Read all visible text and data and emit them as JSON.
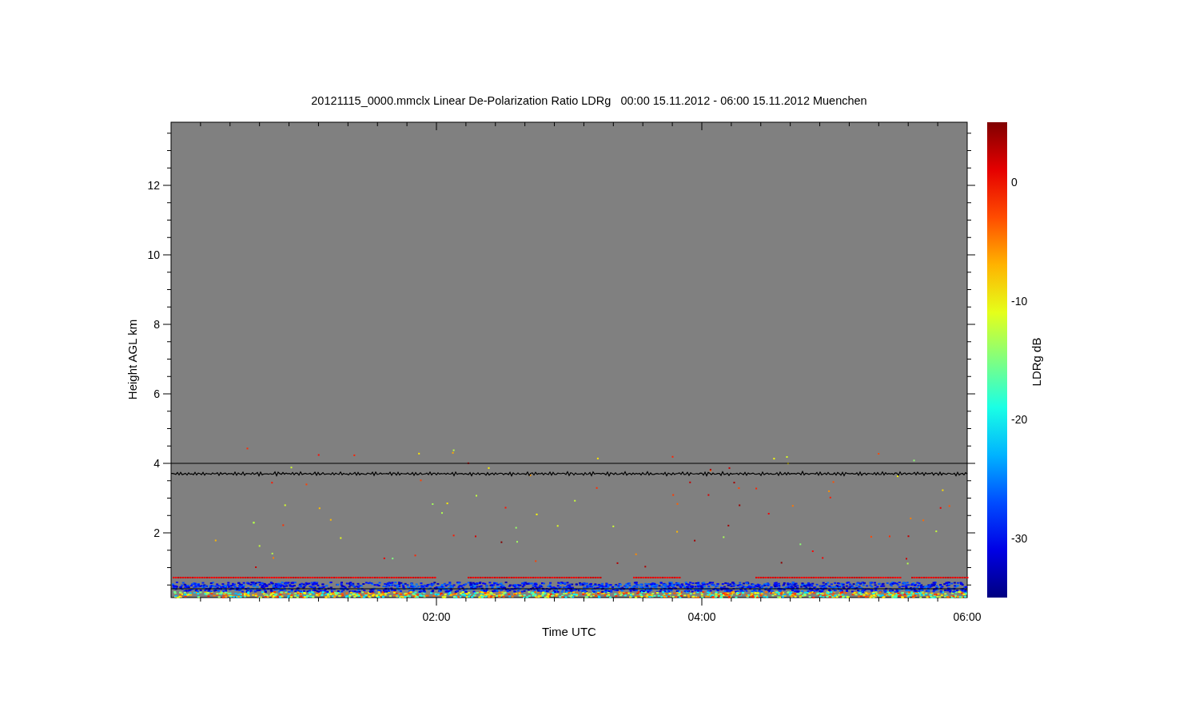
{
  "plot": {
    "title": "20121115_0000.mmclx Linear De-Polarization Ratio LDRg   00:00 15.11.2012 - 06:00 15.11.2012 Muenchen",
    "xlabel": "Time UTC",
    "ylabel": "Height AGL km",
    "yticks": [
      "12",
      "10",
      "8",
      "6",
      "4",
      "2"
    ],
    "xticks": [
      "02:00",
      "04:00",
      "06:00"
    ]
  },
  "colorbar": {
    "label": "LDRg dB",
    "ticks": [
      "0",
      "-10",
      "-20",
      "-30"
    ]
  }
}
